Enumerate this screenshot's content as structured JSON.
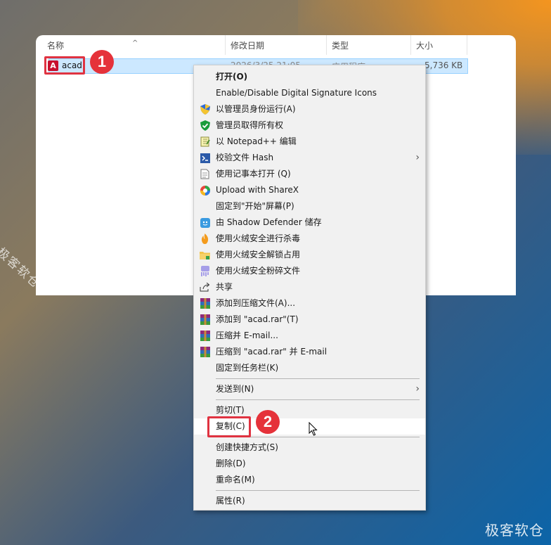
{
  "explorer": {
    "columns": [
      "名称",
      "修改日期",
      "类型",
      "大小"
    ],
    "file": {
      "icon": "autocad-icon",
      "icon_letter": "A",
      "name": "acad",
      "modified": "2026/3/25 21:05",
      "type": "应用程序",
      "size": "5,736 KB"
    }
  },
  "badges": [
    "1",
    "2"
  ],
  "menu": {
    "items": [
      {
        "label": "打开(O)",
        "icon": "none"
      },
      {
        "label": "Enable/Disable Digital Signature Icons",
        "icon": "none"
      },
      {
        "label": "以管理员身份运行(A)",
        "icon": "uac-shield-icon"
      },
      {
        "label": "管理员取得所有权",
        "icon": "green-shield-icon"
      },
      {
        "label": "以 Notepad++ 编辑",
        "icon": "notepadpp-icon"
      },
      {
        "label": "校验文件 Hash",
        "icon": "hash-icon",
        "submenu": true
      },
      {
        "label": "使用记事本打开 (Q)",
        "icon": "notepad-icon"
      },
      {
        "label": "Upload with ShareX",
        "icon": "sharex-icon"
      },
      {
        "label": "固定到\"开始\"屏幕(P)",
        "icon": "none"
      },
      {
        "label": "由 Shadow Defender 储存",
        "icon": "shadow-defender-icon"
      },
      {
        "label": "使用火绒安全进行杀毒",
        "icon": "huorong-flame-icon"
      },
      {
        "label": "使用火绒安全解锁占用",
        "icon": "huorong-folder-icon"
      },
      {
        "label": "使用火绒安全粉碎文件",
        "icon": "huorong-shred-icon"
      },
      {
        "label": "共享",
        "icon": "share-icon"
      },
      {
        "label": "添加到压缩文件(A)...",
        "icon": "winrar-icon"
      },
      {
        "label": "添加到 \"acad.rar\"(T)",
        "icon": "winrar-icon"
      },
      {
        "label": "压缩并 E-mail...",
        "icon": "winrar-icon"
      },
      {
        "label": "压缩到 \"acad.rar\" 并 E-mail",
        "icon": "winrar-icon"
      },
      {
        "label": "固定到任务栏(K)",
        "icon": "none"
      },
      {
        "label": "发送到(N)",
        "icon": "none",
        "submenu": true
      },
      {
        "label": "剪切(T)",
        "icon": "none"
      },
      {
        "label": "复制(C)",
        "icon": "none"
      },
      {
        "label": "创建快捷方式(S)",
        "icon": "none"
      },
      {
        "label": "删除(D)",
        "icon": "none"
      },
      {
        "label": "重命名(M)",
        "icon": "none"
      },
      {
        "label": "属性(R)",
        "icon": "none"
      }
    ]
  },
  "watermarks": [
    "极客软仓",
    "极客软仓"
  ],
  "colors": {
    "highlight_red": "#e03341",
    "selection_blue": "#cce8ff",
    "menu_bg": "#f1f1f1",
    "accent_orange": "#f4951f"
  }
}
